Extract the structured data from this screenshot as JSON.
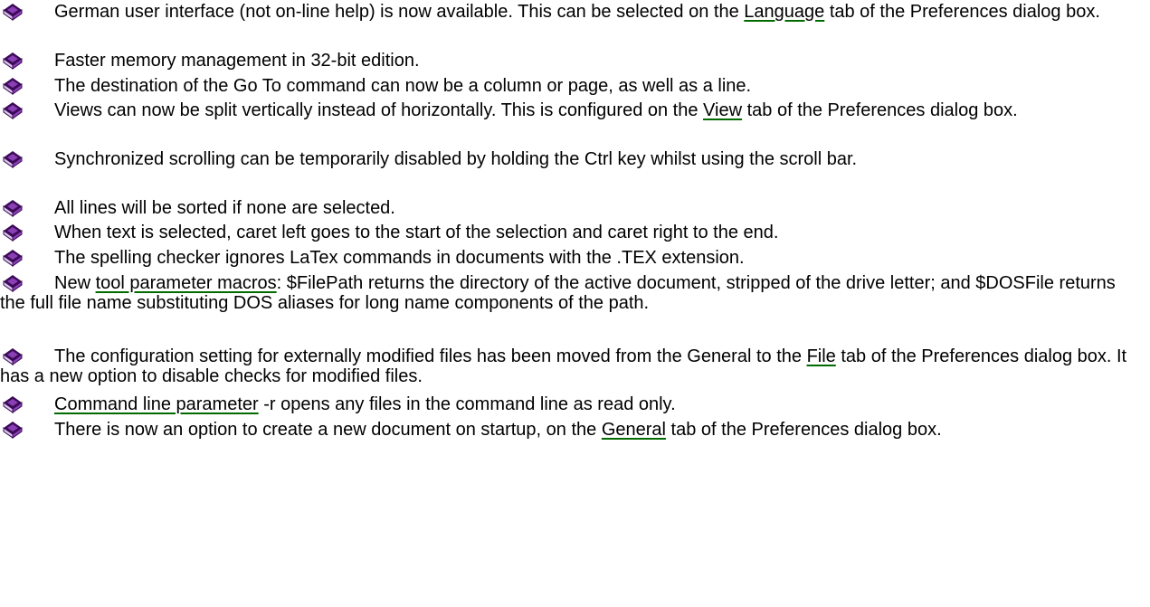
{
  "colors": {
    "text": "#000000",
    "link_underline": "#006a00",
    "bullet_dark": "#3b0a57",
    "bullet_mid": "#8a3fb5",
    "bullet_light": "#d8c8e8",
    "background": "#ffffff"
  },
  "bullet_icon": "book-bullet-icon",
  "items": [
    {
      "parts": [
        {
          "text": "German user interface (not on-line help) is now available.   This can be selected on the "
        },
        {
          "text": "Language",
          "link": true
        },
        {
          "text": " tab of the Preferences dialog box."
        }
      ]
    },
    {
      "parts": [
        {
          "text": "Faster memory management in 32-bit edition."
        }
      ]
    },
    {
      "parts": [
        {
          "text": "The destination of the Go To command can now be a column or page, as well as a line."
        }
      ]
    },
    {
      "parts": [
        {
          "text": "Views can now be split vertically instead of horizontally.   This is configured on the "
        },
        {
          "text": "View",
          "link": true
        },
        {
          "text": " tab of the Preferences dialog box."
        }
      ]
    },
    {
      "parts": [
        {
          "text": "Synchronized scrolling can be temporarily disabled by holding the Ctrl key whilst using the scroll bar."
        }
      ]
    },
    {
      "parts": [
        {
          "text": "All lines will be sorted if none are selected."
        }
      ]
    },
    {
      "parts": [
        {
          "text": "When text is selected, caret left goes to the start of the selection and caret right to the end."
        }
      ]
    },
    {
      "parts": [
        {
          "text": "The spelling checker ignores LaTex commands in documents with the .TEX extension."
        }
      ]
    },
    {
      "parts": [
        {
          "text": "New "
        },
        {
          "text": "tool parameter macros",
          "link": true
        },
        {
          "text": ": $FilePath returns the directory of the active document, stripped of the drive letter; and $DOSFile returns the full file name substituting DOS aliases for long name components of the path."
        }
      ]
    },
    {
      "parts": [
        {
          "text": "The configuration setting for externally modified files has been moved from the General to the "
        },
        {
          "text": "File",
          "link": true
        },
        {
          "text": " tab of the Preferences dialog box.   It has a new option to disable checks for modified files."
        }
      ]
    },
    {
      "parts": [
        {
          "text": "Command line parameter",
          "link": true
        },
        {
          "text": " -r opens any files in the command line as read only."
        }
      ]
    },
    {
      "parts": [
        {
          "text": "There is now an option to create a new document on startup, on the "
        },
        {
          "text": "General",
          "link": true
        },
        {
          "text": " tab of the Preferences dialog box."
        }
      ]
    }
  ]
}
